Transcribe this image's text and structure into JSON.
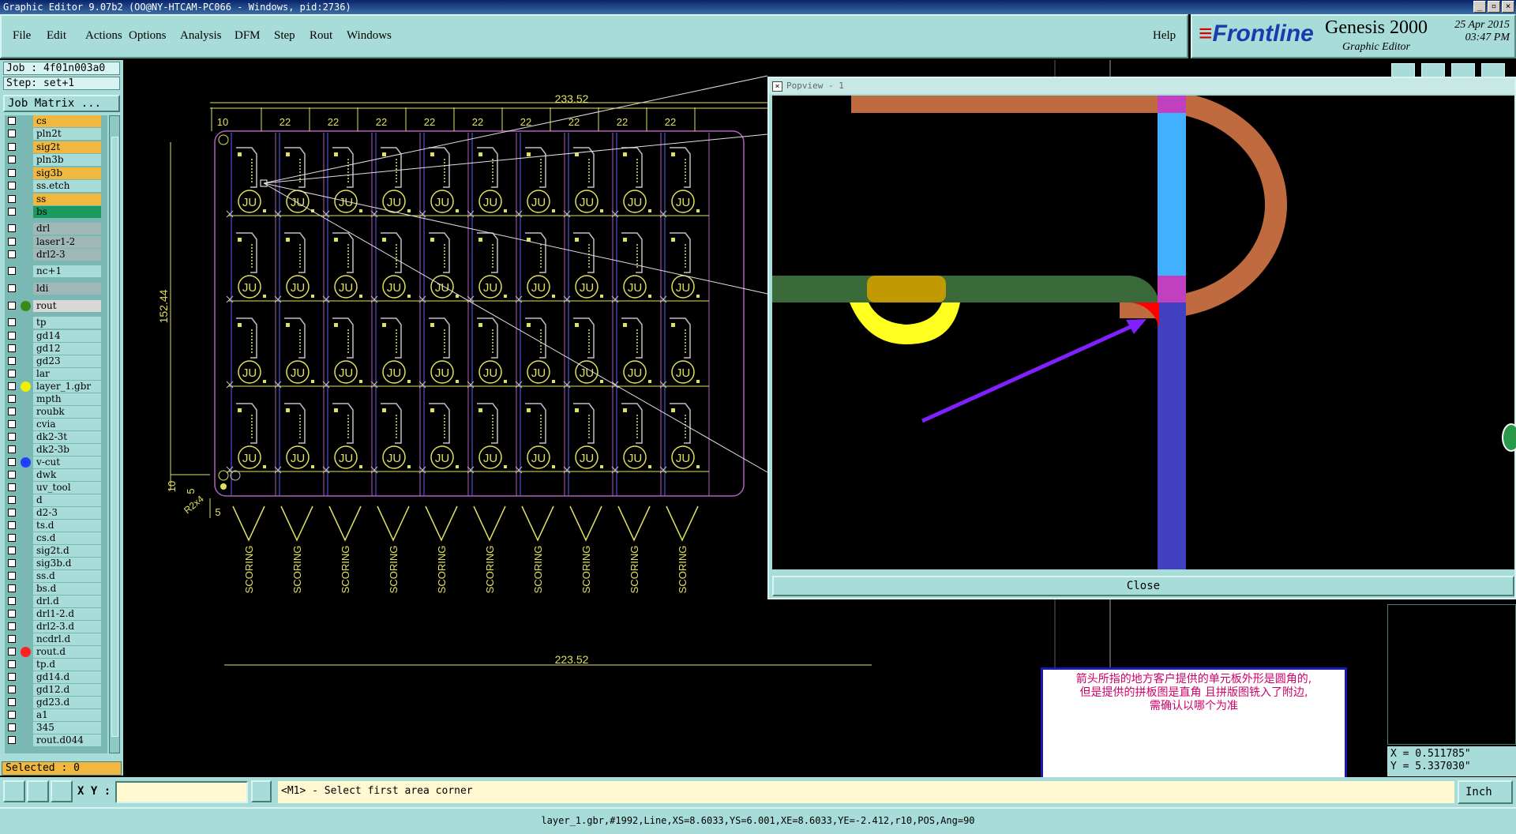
{
  "window": {
    "title": "Graphic Editor 9.07b2 (OO@NY-HTCAM-PC066 - Windows, pid:2736)"
  },
  "menu": {
    "items": [
      "File",
      "Edit",
      "Actions",
      "Options",
      "Analysis",
      "DFM",
      "Step",
      "Rout",
      "Windows"
    ],
    "help": "Help"
  },
  "brand": {
    "logo": "Frontline",
    "product": "Genesis 2000",
    "subtitle": "Graphic Editor",
    "date": "25 Apr 2015",
    "time": "03:47 PM"
  },
  "job": {
    "job_label": "Job : 4f01n003a0",
    "step_label": "Step: set+1",
    "matrix_button": "Job Matrix ..."
  },
  "layers": [
    {
      "name": "cs",
      "style": "orange"
    },
    {
      "name": "pln2t",
      "style": "normal"
    },
    {
      "name": "sig2t",
      "style": "orange"
    },
    {
      "name": "pln3b",
      "style": "normal"
    },
    {
      "name": "sig3b",
      "style": "orange"
    },
    {
      "name": "ss.etch",
      "style": "normal"
    },
    {
      "name": "ss",
      "style": "orange"
    },
    {
      "name": "bs",
      "style": "green"
    },
    {
      "name": "drl",
      "style": "gray"
    },
    {
      "name": "laser1-2",
      "style": "gray"
    },
    {
      "name": "drl2-3",
      "style": "gray"
    },
    {
      "name": "nc+1",
      "style": "normal"
    },
    {
      "name": "ldi",
      "style": "gray"
    },
    {
      "name": "rout",
      "style": "white",
      "dot": "#3a8a1a"
    },
    {
      "name": "tp",
      "style": "normal"
    },
    {
      "name": "gd14",
      "style": "normal"
    },
    {
      "name": "gd12",
      "style": "normal"
    },
    {
      "name": "gd23",
      "style": "normal"
    },
    {
      "name": "lar",
      "style": "normal"
    },
    {
      "name": "layer_1.gbr",
      "style": "normal",
      "dot": "#f0f000"
    },
    {
      "name": "mpth",
      "style": "normal"
    },
    {
      "name": "roubk",
      "style": "normal"
    },
    {
      "name": "cvia",
      "style": "normal"
    },
    {
      "name": "dk2-3t",
      "style": "normal"
    },
    {
      "name": "dk2-3b",
      "style": "normal"
    },
    {
      "name": "v-cut",
      "style": "normal",
      "dot": "#2040ff"
    },
    {
      "name": "dwk",
      "style": "normal"
    },
    {
      "name": "uv_tool",
      "style": "normal"
    },
    {
      "name": "d",
      "style": "normal"
    },
    {
      "name": "d2-3",
      "style": "normal"
    },
    {
      "name": "ts.d",
      "style": "normal"
    },
    {
      "name": "cs.d",
      "style": "normal"
    },
    {
      "name": "sig2t.d",
      "style": "normal"
    },
    {
      "name": "sig3b.d",
      "style": "normal"
    },
    {
      "name": "ss.d",
      "style": "normal"
    },
    {
      "name": "bs.d",
      "style": "normal"
    },
    {
      "name": "drl.d",
      "style": "normal"
    },
    {
      "name": "drl1-2.d",
      "style": "normal"
    },
    {
      "name": "drl2-3.d",
      "style": "normal"
    },
    {
      "name": "ncdrl.d",
      "style": "normal"
    },
    {
      "name": "rout.d",
      "style": "normal",
      "dot": "#ff2020"
    },
    {
      "name": "tp.d",
      "style": "normal"
    },
    {
      "name": "gd14.d",
      "style": "normal"
    },
    {
      "name": "gd12.d",
      "style": "normal"
    },
    {
      "name": "gd23.d",
      "style": "normal"
    },
    {
      "name": "a1",
      "style": "normal"
    },
    {
      "name": "345",
      "style": "normal"
    },
    {
      "name": "rout.d044",
      "style": "normal"
    }
  ],
  "selected": "Selected : 0",
  "drawing": {
    "dim_top_total": "233.52",
    "dim_top_first": "10",
    "dim_top_pitch": "22",
    "dim_left": "152.44",
    "dim_bottom_total": "223.52",
    "dim_bottom_left_10": "10",
    "dim_bottom_left_5a": "5",
    "dim_bottom_left_5b": "5",
    "dim_radius": "R2x4",
    "unit_label": "JU",
    "scoring_label": "SCORING",
    "columns": 10,
    "rows": 4
  },
  "popview": {
    "title": "Popview - 1",
    "close_label": "Close"
  },
  "annotation": {
    "line1": "箭头所指的地方客户提供的单元板外形是圆角的,",
    "line2": "但是提供的拼板图是直角 且拼版图铣入了附边,",
    "line3": "需确认以哪个为准"
  },
  "coords": {
    "x": "X = 0.511785\"",
    "y": "Y = 5.337030\""
  },
  "bottom": {
    "xy_label": "X Y :",
    "xy_value": "",
    "hint": "<M1> - Select first area corner",
    "units": "Inch"
  },
  "status": "layer_1.gbr,#1992,Line,XS=8.6033,YS=6.001,XE=8.6033,YE=-2.412,r10,POS,Ang=90"
}
